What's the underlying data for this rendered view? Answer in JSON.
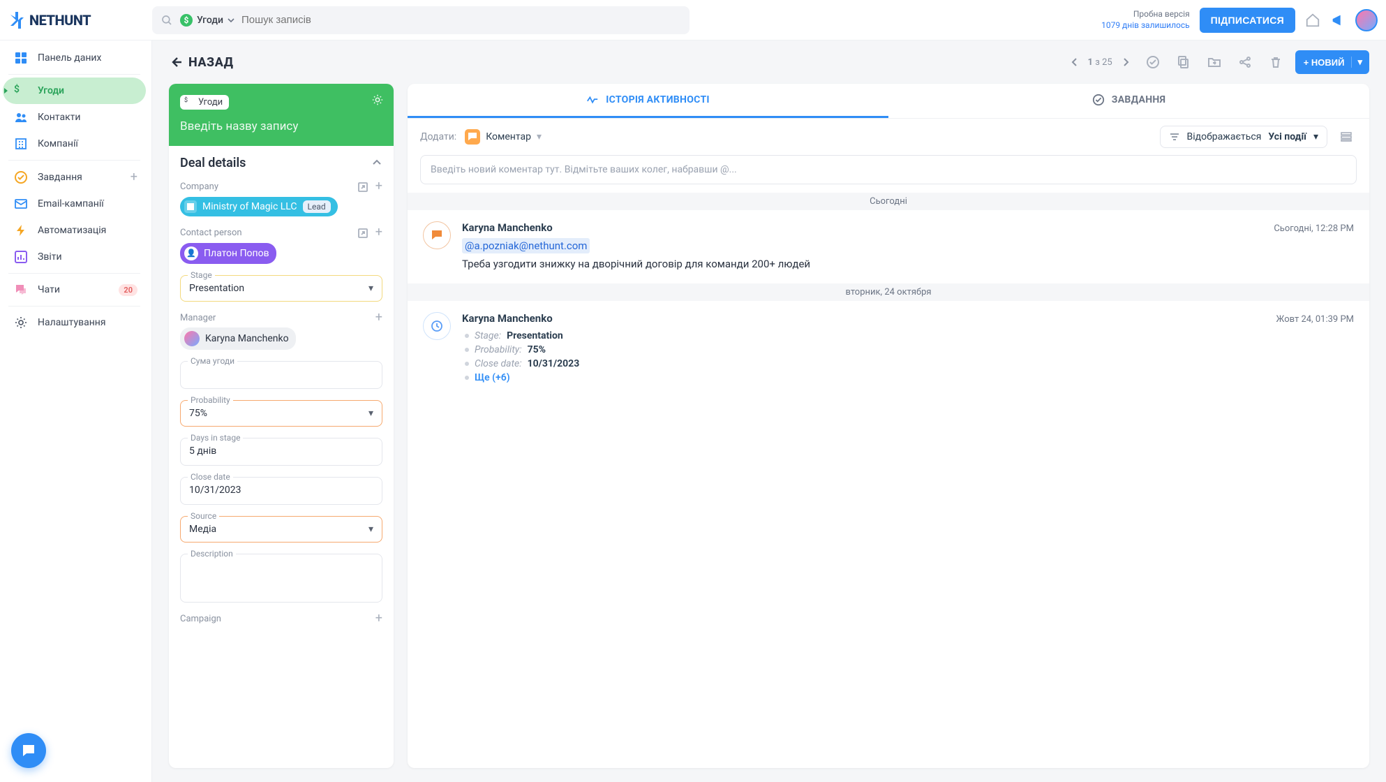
{
  "app": {
    "name": "NETHUNT"
  },
  "search": {
    "folder": "Угоди",
    "placeholder": "Пошук записів"
  },
  "trial": {
    "line1": "Пробна версія",
    "days": "1079 днів залишилось",
    "subscribe": "ПІДПИСАТИСЯ"
  },
  "sidebar": {
    "items": [
      {
        "label": "Панель даних",
        "icon": "dashboard"
      },
      {
        "label": "Угоди",
        "icon": "dollar",
        "active": true
      },
      {
        "label": "Контакти",
        "icon": "people"
      },
      {
        "label": "Компанії",
        "icon": "building"
      },
      {
        "label": "Завдання",
        "icon": "checkcircle",
        "plus": true
      },
      {
        "label": "Email-кампанії",
        "icon": "mail"
      },
      {
        "label": "Автоматизація",
        "icon": "bolt"
      },
      {
        "label": "Звіти",
        "icon": "barchart"
      },
      {
        "label": "Чати",
        "icon": "chat",
        "badge": "20"
      },
      {
        "label": "Налаштування",
        "icon": "gear"
      }
    ]
  },
  "toolbar": {
    "back": "НАЗАД",
    "page": "1",
    "page_sep": "з",
    "page_total": "25",
    "new": "+ НОВИЙ"
  },
  "details": {
    "folder": "Угоди",
    "title_placeholder": "Введіть назву запису",
    "section": "Deal details",
    "company_label": "Company",
    "company_name": "Ministry of Magic LLC",
    "company_stage": "Lead",
    "contact_label": "Contact person",
    "contact_name": "Платон Попов",
    "stage_label": "Stage",
    "stage_value": "Presentation",
    "manager_label": "Manager",
    "manager_name": "Karyna Manchenko",
    "amount_label": "Сума угоди",
    "probability_label": "Probability",
    "probability_value": "75%",
    "days_label": "Days in stage",
    "days_value": "5 днів",
    "close_label": "Close date",
    "close_value": "10/31/2023",
    "source_label": "Source",
    "source_value": "Медіа",
    "description_label": "Description",
    "campaign_label": "Campaign"
  },
  "timeline": {
    "tabs": {
      "activity": "ІСТОРІЯ АКТИВНОСТІ",
      "tasks": "ЗАВДАННЯ"
    },
    "add_label": "Додати:",
    "comment_label": "Коментар",
    "filter_label": "Відображається",
    "filter_value": "Усі події",
    "comment_placeholder": "Введіть новий коментар тут. Відмітьте ваших колег, набравши @...",
    "day1": "Сьогодні",
    "entry1": {
      "author": "Karyna Manchenko",
      "time": "Сьогодні, 12:28 PM",
      "mention": "@a.pozniak@nethunt.com",
      "text": "Треба узгодити знижку на дворічний договір для команди 200+ людей"
    },
    "day2": "вторник, 24 октября",
    "entry2": {
      "author": "Karyna Manchenko",
      "time": "Жовт 24, 01:39 PM",
      "changes": [
        {
          "k": "Stage:",
          "v": "Presentation"
        },
        {
          "k": "Probability:",
          "v": "75%"
        },
        {
          "k": "Close date:",
          "v": "10/31/2023"
        }
      ],
      "more": "Ще (+6)"
    }
  }
}
